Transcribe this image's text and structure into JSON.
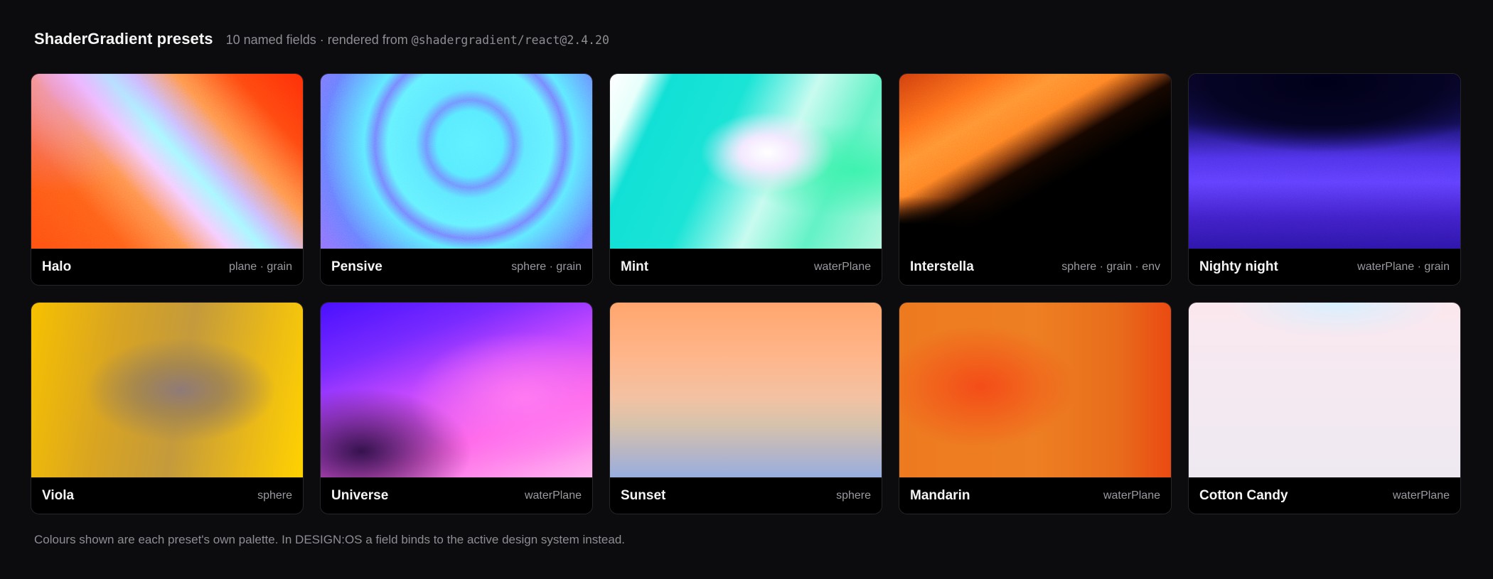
{
  "header": {
    "title": "ShaderGradient presets",
    "subtitle_prefix": "10 named fields · rendered from",
    "subtitle_package": "@shadergradient/react@2.4.20"
  },
  "presets": [
    {
      "name": "Halo",
      "tags": "plane · grain",
      "grain": true
    },
    {
      "name": "Pensive",
      "tags": "sphere · grain",
      "grain": true
    },
    {
      "name": "Mint",
      "tags": "waterPlane",
      "grain": false
    },
    {
      "name": "Interstella",
      "tags": "sphere · grain · env",
      "grain": true
    },
    {
      "name": "Nighty night",
      "tags": "waterPlane · grain",
      "grain": true
    },
    {
      "name": "Viola",
      "tags": "sphere",
      "grain": false
    },
    {
      "name": "Universe",
      "tags": "waterPlane",
      "grain": false
    },
    {
      "name": "Sunset",
      "tags": "sphere",
      "grain": false
    },
    {
      "name": "Mandarin",
      "tags": "waterPlane",
      "grain": false
    },
    {
      "name": "Cotton Candy",
      "tags": "waterPlane",
      "grain": false
    }
  ],
  "footnote": "Colours shown are each preset's own palette. In DESIGN:OS a field binds to the active design system instead.",
  "colors": {
    "background": "#0c0c0e",
    "card_footer": "#000000",
    "muted_text": "#8d8d93"
  }
}
